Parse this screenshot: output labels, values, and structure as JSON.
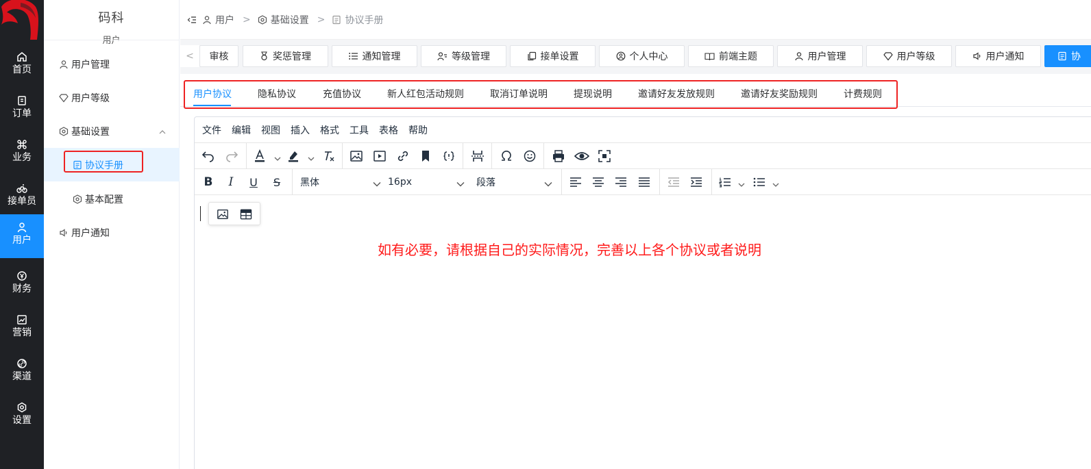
{
  "colors": {
    "primary": "#1890ff",
    "rail_bg": "#1f2125",
    "highlight_red": "#ee2222"
  },
  "rail": {
    "items": [
      {
        "label": "首页",
        "icon": "home-icon"
      },
      {
        "label": "订单",
        "icon": "order-icon"
      },
      {
        "label": "业务",
        "icon": "command-icon"
      },
      {
        "label": "接单员",
        "icon": "bike-icon"
      },
      {
        "label": "用户",
        "icon": "user-icon",
        "active": true
      },
      {
        "label": "财务",
        "icon": "money-icon"
      },
      {
        "label": "营销",
        "icon": "chart-icon"
      },
      {
        "label": "渠道",
        "icon": "link-icon"
      },
      {
        "label": "设置",
        "icon": "gear-icon"
      }
    ]
  },
  "submenu": {
    "brand": "码科",
    "section": "用户",
    "items": [
      {
        "label": "用户管理",
        "icon": "user-icon"
      },
      {
        "label": "用户等级",
        "icon": "diamond-icon"
      },
      {
        "label": "基础设置",
        "icon": "hexagon-icon",
        "expanded": true
      },
      {
        "label": "协议手册",
        "icon": "document-icon",
        "selected": true
      },
      {
        "label": "基本配置",
        "icon": "hexagon-icon"
      },
      {
        "label": "用户通知",
        "icon": "speaker-icon"
      }
    ]
  },
  "breadcrumb": [
    "用户",
    "基础设置",
    "协议手册"
  ],
  "breadcrumb_sep": ">",
  "tags_prev": "<",
  "tags": [
    {
      "label": "审核",
      "icon": ""
    },
    {
      "label": "奖惩管理",
      "icon": "medal-icon"
    },
    {
      "label": "通知管理",
      "icon": "list-icon"
    },
    {
      "label": "等级管理",
      "icon": "user-list-icon"
    },
    {
      "label": "接单设置",
      "icon": "copy-icon"
    },
    {
      "label": "个人中心",
      "icon": "location-user-icon"
    },
    {
      "label": "前端主题",
      "icon": "book-icon"
    },
    {
      "label": "用户管理",
      "icon": "user-icon"
    },
    {
      "label": "用户等级",
      "icon": "diamond-icon"
    },
    {
      "label": "用户通知",
      "icon": "speaker-icon"
    },
    {
      "label": "协",
      "icon": "document-icon",
      "active": true
    }
  ],
  "agreement_tabs": [
    {
      "label": "用户协议",
      "active": true
    },
    {
      "label": "隐私协议"
    },
    {
      "label": "充值协议"
    },
    {
      "label": "新人红包活动规则"
    },
    {
      "label": "取消订单说明"
    },
    {
      "label": "提现说明"
    },
    {
      "label": "邀请好友发放规则"
    },
    {
      "label": "邀请好友奖励规则"
    },
    {
      "label": "计费规则"
    }
  ],
  "editor": {
    "menubar": [
      "文件",
      "编辑",
      "视图",
      "插入",
      "格式",
      "工具",
      "表格",
      "帮助"
    ],
    "font_family": "黑体",
    "font_size": "16px",
    "block_format": "段落",
    "note": "如有必要，请根据自己的实际情况，完善以上各个协议或者说明"
  }
}
